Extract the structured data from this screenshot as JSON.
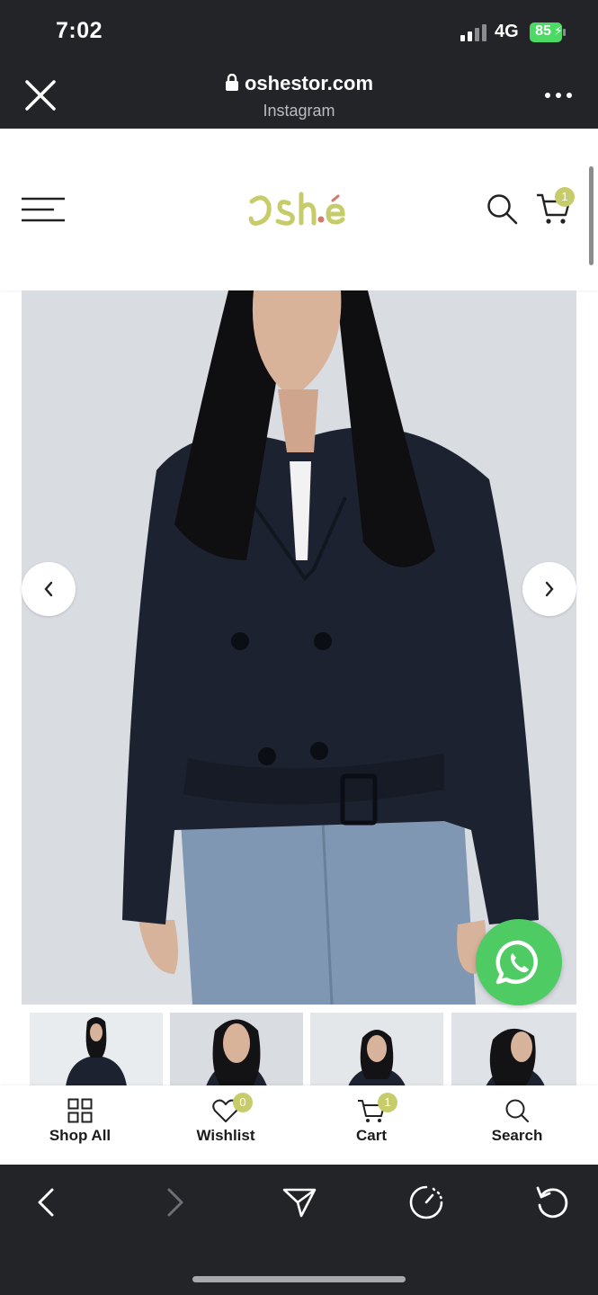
{
  "status_bar": {
    "time": "7:02",
    "network": "4G",
    "battery": "85"
  },
  "browser": {
    "url": "oshestor.com",
    "source": "Instagram"
  },
  "site": {
    "logo_text": "OSh.é",
    "cart_count": "1",
    "accent_color": "#c7cc6a"
  },
  "bottom_nav": {
    "items": [
      {
        "label": "Shop All",
        "icon": "grid-icon"
      },
      {
        "label": "Wishlist",
        "icon": "heart-icon",
        "badge": "0"
      },
      {
        "label": "Cart",
        "icon": "cart-icon",
        "badge": "1"
      },
      {
        "label": "Search",
        "icon": "search-icon"
      }
    ]
  },
  "colors": {
    "chrome": "#222428",
    "whatsapp": "#4fcb63",
    "jacket": "#1c2230",
    "jeans": "#7f97b3"
  }
}
